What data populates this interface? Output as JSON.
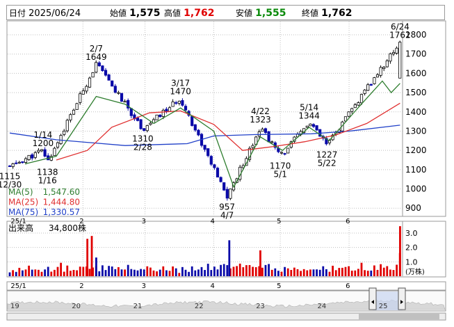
{
  "header": {
    "date_label": "日付",
    "date": "2025/06/24",
    "open_label": "始値",
    "open": "1,575",
    "high_label": "高値",
    "high": "1,762",
    "low_label": "安値",
    "low": "1,555",
    "close_label": "終値",
    "close": "1,762"
  },
  "colors": {
    "up": "#e00000",
    "down": "#0a0aa8",
    "ma5": "#2e7d2e",
    "ma25": "#e03030",
    "ma75": "#2040c8"
  },
  "chart_data": [
    {
      "type": "candlestick",
      "y_ticks": [
        "1800",
        "1700",
        "1600",
        "1500",
        "1400",
        "1300",
        "1200",
        "1100",
        "1000",
        "900"
      ],
      "ylim": [
        880,
        1850
      ],
      "x_tick_labels": [
        {
          "label": "25/1",
          "date": "2025-01-01"
        },
        {
          "label": "2",
          "date": "2025-02-01"
        },
        {
          "label": "3",
          "date": "2025-03-01"
        },
        {
          "label": "4",
          "date": "2025-04-01"
        },
        {
          "label": "5",
          "date": "2025-05-01"
        },
        {
          "label": "6",
          "date": "2025-06-01"
        }
      ],
      "annotations": [
        {
          "date_text": "12/30",
          "value_text": "1115",
          "date": "2024-12-30",
          "value": 1115,
          "side": "below"
        },
        {
          "date_text": "1/14",
          "value_text": "1200",
          "date": "2025-01-14",
          "value": 1200,
          "side": "above"
        },
        {
          "date_text": "1/16",
          "value_text": "1138",
          "date": "2025-01-16",
          "value": 1138,
          "side": "below"
        },
        {
          "date_text": "2/7",
          "value_text": "1649",
          "date": "2025-02-07",
          "value": 1649,
          "side": "above"
        },
        {
          "date_text": "2/28",
          "value_text": "1310",
          "date": "2025-02-28",
          "value": 1310,
          "side": "below"
        },
        {
          "date_text": "3/17",
          "value_text": "1470",
          "date": "2025-03-17",
          "value": 1470,
          "side": "above"
        },
        {
          "date_text": "4/7",
          "value_text": "957",
          "date": "2025-04-07",
          "value": 957,
          "side": "below"
        },
        {
          "date_text": "4/22",
          "value_text": "1323",
          "date": "2025-04-22",
          "value": 1323,
          "side": "above"
        },
        {
          "date_text": "5/1",
          "value_text": "1170",
          "date": "2025-05-01",
          "value": 1170,
          "side": "below"
        },
        {
          "date_text": "5/14",
          "value_text": "1344",
          "date": "2025-05-14",
          "value": 1344,
          "side": "above"
        },
        {
          "date_text": "5/22",
          "value_text": "1227",
          "date": "2025-05-22",
          "value": 1227,
          "side": "below"
        },
        {
          "date_text": "6/24",
          "value_text": "1762",
          "date": "2025-06-24",
          "value": 1762,
          "side": "above"
        }
      ],
      "legend": [
        {
          "name": "MA(5)",
          "value": "1,547.60",
          "color": "#2e7d2e"
        },
        {
          "name": "MA(25)",
          "value": "1,444.80",
          "color": "#e03030"
        },
        {
          "name": "MA(75)",
          "value": "1,330.57",
          "color": "#2040c8"
        }
      ],
      "price_path": [
        [
          "2024-12-30",
          1115
        ],
        [
          "2025-01-14",
          1200
        ],
        [
          "2025-01-16",
          1138
        ],
        [
          "2025-02-07",
          1649
        ],
        [
          "2025-02-28",
          1310
        ],
        [
          "2025-03-17",
          1470
        ],
        [
          "2025-04-07",
          957
        ],
        [
          "2025-04-22",
          1323
        ],
        [
          "2025-05-01",
          1170
        ],
        [
          "2025-05-14",
          1344
        ],
        [
          "2025-05-22",
          1227
        ],
        [
          "2025-06-24",
          1762
        ]
      ],
      "ma5_path": [
        [
          "2025-01-06",
          1130
        ],
        [
          "2025-01-20",
          1170
        ],
        [
          "2025-02-07",
          1480
        ],
        [
          "2025-02-20",
          1440
        ],
        [
          "2025-03-05",
          1340
        ],
        [
          "2025-03-17",
          1420
        ],
        [
          "2025-04-01",
          1300
        ],
        [
          "2025-04-10",
          1010
        ],
        [
          "2025-04-22",
          1270
        ],
        [
          "2025-05-02",
          1200
        ],
        [
          "2025-05-14",
          1320
        ],
        [
          "2025-05-23",
          1250
        ],
        [
          "2025-06-05",
          1420
        ],
        [
          "2025-06-16",
          1560
        ],
        [
          "2025-06-20",
          1500
        ],
        [
          "2025-06-24",
          1548
        ]
      ],
      "ma25_path": [
        [
          "2025-01-20",
          1150
        ],
        [
          "2025-02-03",
          1200
        ],
        [
          "2025-02-14",
          1320
        ],
        [
          "2025-03-03",
          1395
        ],
        [
          "2025-03-17",
          1405
        ],
        [
          "2025-04-01",
          1335
        ],
        [
          "2025-04-14",
          1200
        ],
        [
          "2025-04-28",
          1220
        ],
        [
          "2025-05-12",
          1245
        ],
        [
          "2025-05-26",
          1280
        ],
        [
          "2025-06-09",
          1340
        ],
        [
          "2025-06-24",
          1445
        ]
      ],
      "ma75_path": [
        [
          "2024-12-30",
          1290
        ],
        [
          "2025-01-20",
          1255
        ],
        [
          "2025-02-20",
          1225
        ],
        [
          "2025-03-20",
          1235
        ],
        [
          "2025-04-01",
          1275
        ],
        [
          "2025-04-20",
          1282
        ],
        [
          "2025-05-15",
          1286
        ],
        [
          "2025-06-01",
          1300
        ],
        [
          "2025-06-24",
          1331
        ]
      ]
    },
    {
      "type": "bar",
      "name": "出来高",
      "title": "出来高",
      "value_text": "34,800株",
      "unit": "(万株)",
      "y_ticks": [
        "3.0",
        "2.0",
        "1.0"
      ],
      "ylim": [
        0,
        4.0
      ],
      "spikes": [
        {
          "date": "2025-02-03",
          "value": 2.6,
          "dir": "up"
        },
        {
          "date": "2025-02-05",
          "value": 2.8,
          "dir": "up"
        },
        {
          "date": "2025-02-07",
          "value": 1.3,
          "dir": "down"
        },
        {
          "date": "2025-04-08",
          "value": 2.5,
          "dir": "down"
        },
        {
          "date": "2025-04-22",
          "value": 1.8,
          "dir": "up"
        },
        {
          "date": "2025-06-24",
          "value": 3.48,
          "dir": "up"
        }
      ]
    }
  ],
  "overview": {
    "labels": [
      "19",
      "20",
      "21",
      "22",
      "23",
      "24",
      "25"
    ]
  }
}
